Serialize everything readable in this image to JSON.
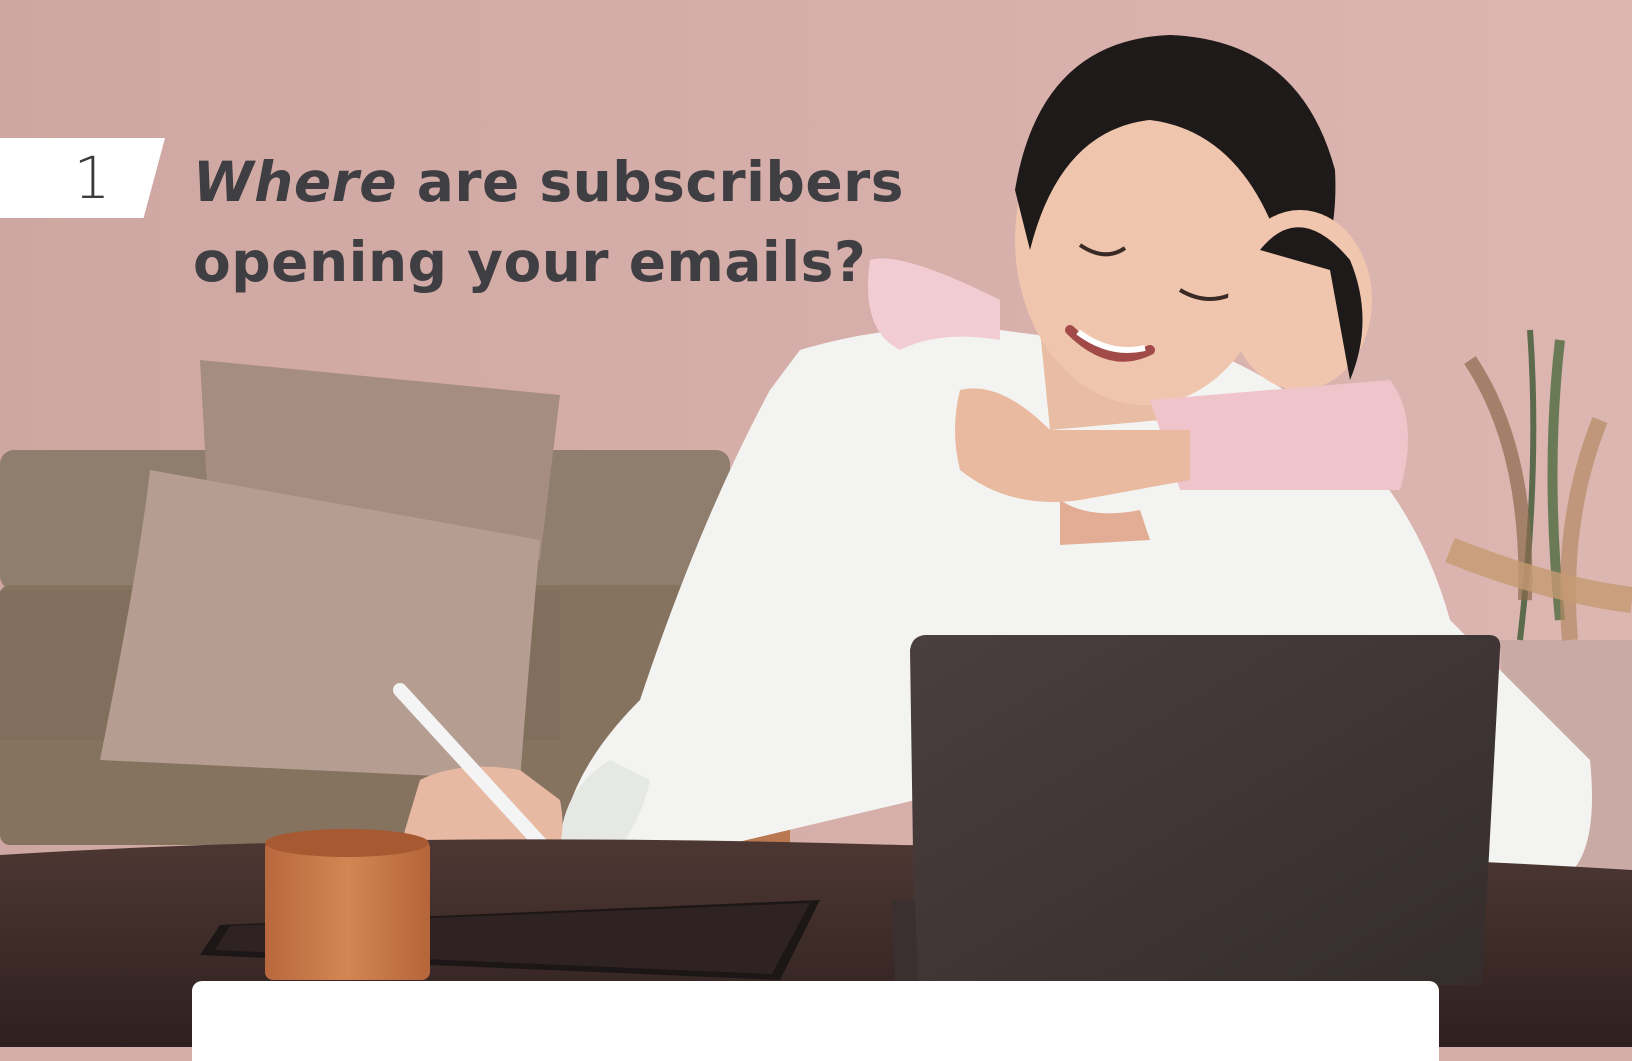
{
  "step": {
    "number": "1"
  },
  "headline": {
    "emphasis": "Where",
    "line1_rest": " are subscribers",
    "line2": "opening your emails?"
  },
  "colors": {
    "wall": "#d6aea9",
    "sofa": "#8f7d6e",
    "cushion": "#b59d91",
    "sweater": "#f3f4f1",
    "table": "#3f2d2a",
    "laptop": "#433838",
    "mug": "#c8794a",
    "text": "#3f3e42"
  },
  "scene": {
    "description_icons": [
      "woman-at-laptop-illustration",
      "child-hugging-illustration",
      "sofa-illustration",
      "plant-illustration",
      "mug-illustration",
      "tablet-illustration"
    ]
  }
}
